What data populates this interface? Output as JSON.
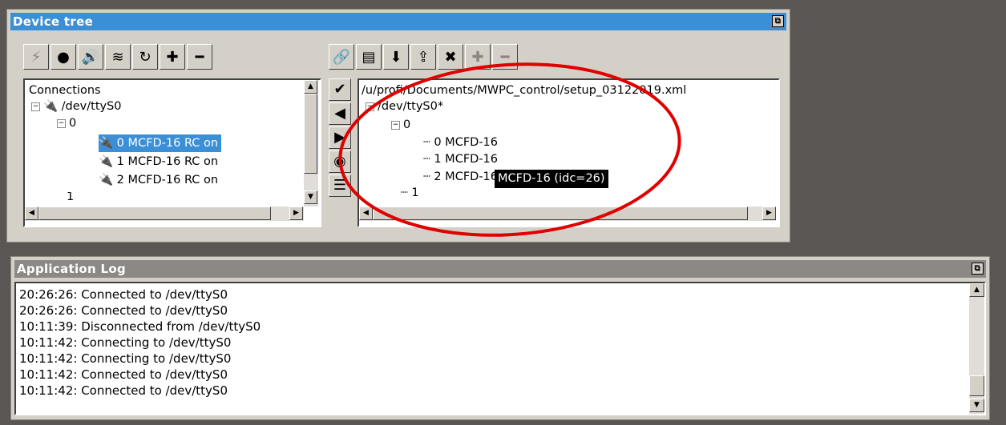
{
  "device_tree": {
    "title": "Device tree",
    "float_icon": "float-window-icon",
    "left_toolbar": [
      {
        "name": "disconnect-icon",
        "glyph": "⚡",
        "disabled": true
      },
      {
        "name": "record-icon",
        "glyph": "●",
        "disabled": false
      },
      {
        "name": "speaker-icon",
        "glyph": "🔊",
        "disabled": false
      },
      {
        "name": "wireless-icon",
        "glyph": "≋",
        "disabled": false
      },
      {
        "name": "refresh-icon",
        "glyph": "↻",
        "disabled": false
      },
      {
        "name": "add-icon",
        "glyph": "✚",
        "disabled": false
      },
      {
        "name": "remove-icon",
        "glyph": "━",
        "disabled": false
      }
    ],
    "right_toolbar": [
      {
        "name": "link-icon",
        "glyph": "🔗",
        "disabled": false
      },
      {
        "name": "open-folder-icon",
        "glyph": "▤",
        "disabled": false
      },
      {
        "name": "save-icon",
        "glyph": "⬇",
        "disabled": false
      },
      {
        "name": "export-icon",
        "glyph": "⇪",
        "disabled": false
      },
      {
        "name": "delete-icon",
        "glyph": "✖",
        "disabled": false
      },
      {
        "name": "add-icon",
        "glyph": "✚",
        "disabled": true
      },
      {
        "name": "remove-icon",
        "glyph": "━",
        "disabled": true
      }
    ],
    "connections": {
      "header": "Connections",
      "port": "/dev/ttyS0",
      "bus0": "0",
      "devices": [
        {
          "label": "0 MCFD-16 RC on",
          "selected": true
        },
        {
          "label": "1 MCFD-16 RC on",
          "selected": false
        },
        {
          "label": "2 MCFD-16 RC on",
          "selected": false
        }
      ],
      "bus1": "1"
    },
    "side_buttons": [
      {
        "name": "apply-icon",
        "glyph": "✔"
      },
      {
        "name": "arrow-left-icon",
        "glyph": "◀"
      },
      {
        "name": "arrow-right-icon",
        "glyph": "▶"
      },
      {
        "name": "poll-icon",
        "glyph": "◉"
      },
      {
        "name": "list-icon",
        "glyph": "☰"
      }
    ],
    "setup": {
      "path": "/u/profi/Documents/MWPC_control/setup_03122019.xml",
      "port": "/dev/ttyS0*",
      "bus0": "0",
      "devices": [
        "0 MCFD-16",
        "1 MCFD-16",
        "2 MCFD-16"
      ],
      "bus1": "1",
      "tooltip": "MCFD-16 (idc=26)"
    }
  },
  "app_log": {
    "title": "Application Log",
    "lines": [
      "20:26:26: Connected to /dev/ttyS0",
      "20:26:26: Connected to /dev/ttyS0",
      "10:11:39: Disconnected from /dev/ttyS0",
      "10:11:42: Connecting to /dev/ttyS0",
      "10:11:42: Connecting to /dev/ttyS0",
      "10:11:42: Connected to /dev/ttyS0",
      "10:11:42: Connected to /dev/ttyS0"
    ]
  },
  "colors": {
    "accent": "#3b8fd6",
    "annotation": "#e00000"
  }
}
